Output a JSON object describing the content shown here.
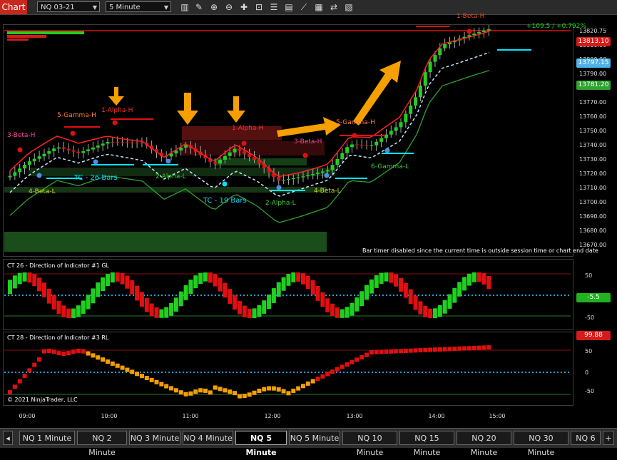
{
  "toolbar": {
    "chart_label": "Chart",
    "instrument": "NQ 03-21",
    "interval": "5 Minute",
    "icons": [
      "bars-icon",
      "pencil-icon",
      "zoom-in-icon",
      "zoom-out-icon",
      "crosshair-icon",
      "tile-icon",
      "properties-icon",
      "strategy-icon",
      "indicator-icon",
      "data-box-icon",
      "share-icon",
      "layout-icon"
    ]
  },
  "price_panel": {
    "pnl": "+109.5 / +0.792%",
    "y_ticks": [
      "13820.75",
      "13810.00",
      "13800.00",
      "13790.00",
      "13780.00",
      "13770.00",
      "13760.00",
      "13750.00",
      "13740.00",
      "13730.00",
      "13720.00",
      "13710.00",
      "13700.00",
      "13690.00",
      "13680.00",
      "13670.00"
    ],
    "price_tags": [
      {
        "text": "13813.10",
        "bg": "#d61a1a"
      },
      {
        "text": "13797.15",
        "bg": "#4fb3e8"
      },
      {
        "text": "13781.20",
        "bg": "#2fa32f"
      }
    ],
    "labels": {
      "beta_h_top": "1-Beta-H",
      "gamma5": "5-Gamma-H",
      "alpha1h": "1-Alpha-H",
      "beta3h_left": "3-Beta-H",
      "alpha_h_mid": "1-Alpha-H",
      "gamma5b": "5-Gamma-H",
      "beta3h_mid": "3-Beta-H",
      "tc26": "TC - 26 Bars",
      "alpha2l": "2-Alpha-L",
      "beta4l_left": "4-Beta-L",
      "tc19": "TC - 19 Bars",
      "alpha2l_b": "2-Alpha-L",
      "beta4l_b": "4-Beta-L",
      "gamma6l": "6-Gamma-L"
    },
    "timer_msg": "Bar timer disabled since the current time is outside session time or chart end date"
  },
  "ind1": {
    "title": "CT 26 - Direction of Indicator #1 GL",
    "ticks": [
      "50",
      "0",
      "-50"
    ],
    "value_tag": {
      "text": "-5.5",
      "bg": "#1fb31f"
    }
  },
  "ind2": {
    "title": "CT 28 - Direction of Indicator #3 RL",
    "ticks": [
      "50",
      "0",
      "-50"
    ],
    "value_tag": {
      "text": "99.88",
      "bg": "#d61a1a"
    },
    "copyright": "© 2021 NinjaTrader, LLC"
  },
  "time_axis": [
    "09:00",
    "10:00",
    "11:00",
    "12:00",
    "13:00",
    "14:00",
    "15:00"
  ],
  "colors": {
    "bull": "#1fd11f",
    "bear": "#e01010",
    "orange": "#f5a000",
    "cyan": "#00e5ff",
    "lime": "#7cfc00"
  },
  "tabs": [
    "NQ 1 Minute",
    "NQ 2 Minute",
    "NQ 3 Minute",
    "NQ 4 Minute",
    "NQ 5 Minute",
    "NQ 5 Minute",
    "NQ 10 Minute",
    "NQ 15 Minute",
    "NQ 20 Minute",
    "NQ 30 Minute",
    "NQ 6"
  ],
  "active_tab": 4,
  "add_tab": "+"
}
